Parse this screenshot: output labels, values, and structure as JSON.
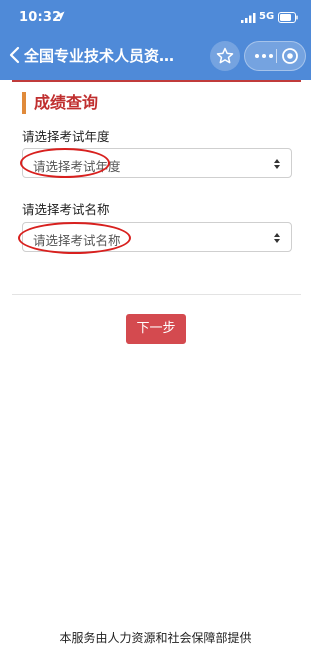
{
  "status_bar": {
    "time": "10:32",
    "network": "5G"
  },
  "navbar": {
    "title": "全国专业技术人员资…"
  },
  "section_title": "成绩查询",
  "year_field": {
    "label": "请选择考试年度",
    "placeholder": "请选择考试年度"
  },
  "name_field": {
    "label": "请选择考试名称",
    "placeholder": "请选择考试名称"
  },
  "next_button": "下一步",
  "footer": "本服务由人力资源和社会保障部提供",
  "colors": {
    "navbar": "#4f8ad8",
    "accent_red": "#c02f2f",
    "title_bar": "#e08a3a",
    "button": "#d44a4f",
    "annotation": "#d8201e"
  },
  "icons": [
    "location-arrow-icon",
    "signal-icon",
    "battery-icon",
    "back-chevron-icon",
    "star-icon",
    "more-dots-icon",
    "mini-program-close-icon",
    "select-caret-icon"
  ]
}
